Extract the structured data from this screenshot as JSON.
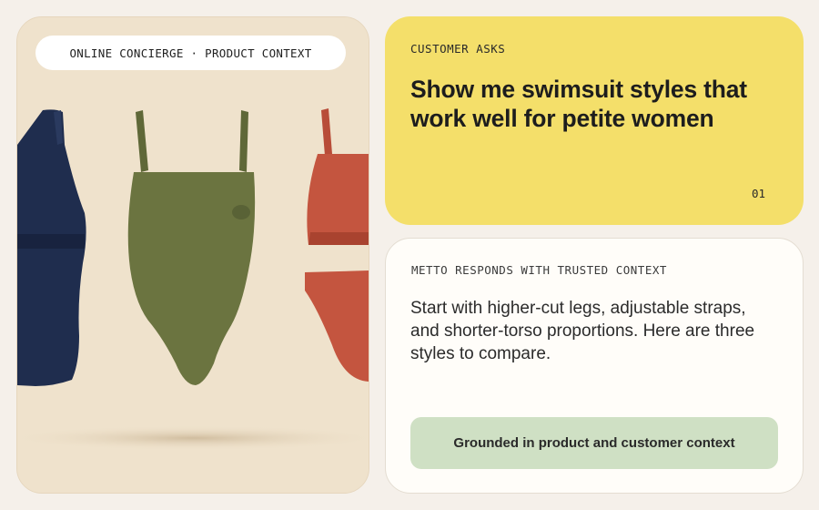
{
  "image_card": {
    "context_label": "ONLINE CONCIERGE · PRODUCT CONTEXT",
    "colors": {
      "navy_swimsuit": "#1f2d4e",
      "olive_swimsuit": "#6b7440",
      "red_bikini": "#c4553f"
    }
  },
  "ask_card": {
    "eyebrow": "CUSTOMER ASKS",
    "question_line1": "Show me swimsuit styles that",
    "question_line2": "work well for petite women",
    "index": "01",
    "background": "#f4df6a"
  },
  "response_card": {
    "eyebrow": "METTO RESPONDS WITH TRUSTED CONTEXT",
    "answer_line1": "Start with higher-cut legs, adjustable straps,",
    "answer_line2": "and shorter-torso proportions. Here are three",
    "answer_line3": "styles to compare.",
    "badge": "Grounded in product and customer context",
    "badge_color": "#cfe0c4"
  }
}
